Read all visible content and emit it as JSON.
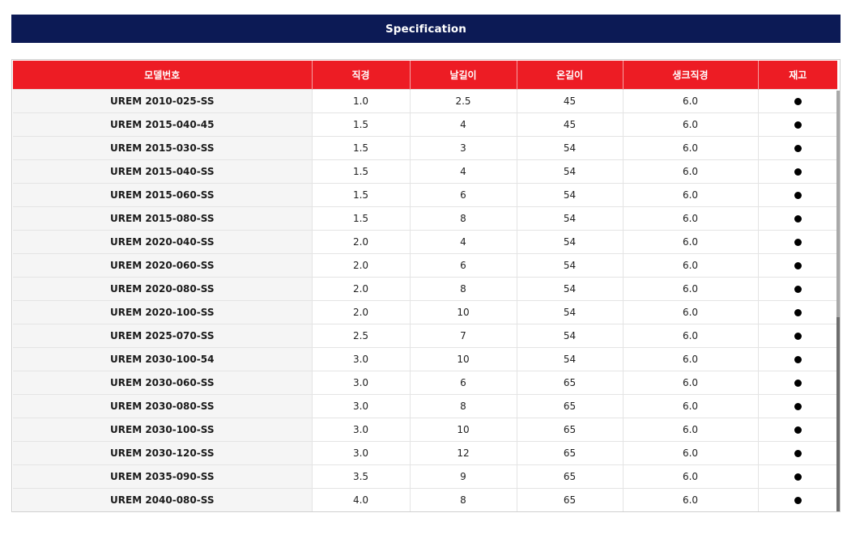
{
  "header": {
    "title": "Specification"
  },
  "table": {
    "columns": [
      "모델번호",
      "직경",
      "날길이",
      "온길이",
      "생크직경",
      "재고"
    ],
    "rows": [
      [
        "UREM 2010-025-SS",
        "1.0",
        "2.5",
        "45",
        "6.0"
      ],
      [
        "UREM 2015-040-45",
        "1.5",
        "4",
        "45",
        "6.0"
      ],
      [
        "UREM 2015-030-SS",
        "1.5",
        "3",
        "54",
        "6.0"
      ],
      [
        "UREM 2015-040-SS",
        "1.5",
        "4",
        "54",
        "6.0"
      ],
      [
        "UREM 2015-060-SS",
        "1.5",
        "6",
        "54",
        "6.0"
      ],
      [
        "UREM 2015-080-SS",
        "1.5",
        "8",
        "54",
        "6.0"
      ],
      [
        "UREM 2020-040-SS",
        "2.0",
        "4",
        "54",
        "6.0"
      ],
      [
        "UREM 2020-060-SS",
        "2.0",
        "6",
        "54",
        "6.0"
      ],
      [
        "UREM 2020-080-SS",
        "2.0",
        "8",
        "54",
        "6.0"
      ],
      [
        "UREM 2020-100-SS",
        "2.0",
        "10",
        "54",
        "6.0"
      ],
      [
        "UREM 2025-070-SS",
        "2.5",
        "7",
        "54",
        "6.0"
      ],
      [
        "UREM 2030-100-54",
        "3.0",
        "10",
        "54",
        "6.0"
      ],
      [
        "UREM 2030-060-SS",
        "3.0",
        "6",
        "65",
        "6.0"
      ],
      [
        "UREM 2030-080-SS",
        "3.0",
        "8",
        "65",
        "6.0"
      ],
      [
        "UREM 2030-100-SS",
        "3.0",
        "10",
        "65",
        "6.0"
      ],
      [
        "UREM 2030-120-SS",
        "3.0",
        "12",
        "65",
        "6.0"
      ],
      [
        "UREM 2035-090-SS",
        "3.5",
        "9",
        "65",
        "6.0"
      ],
      [
        "UREM 2040-080-SS",
        "4.0",
        "8",
        "65",
        "6.0"
      ]
    ],
    "stock_icon": "filled-circle-icon"
  },
  "colors": {
    "header_bg": "#0c1a55",
    "table_header_bg": "#ed1c24",
    "model_cell_bg": "#f5f5f5"
  }
}
